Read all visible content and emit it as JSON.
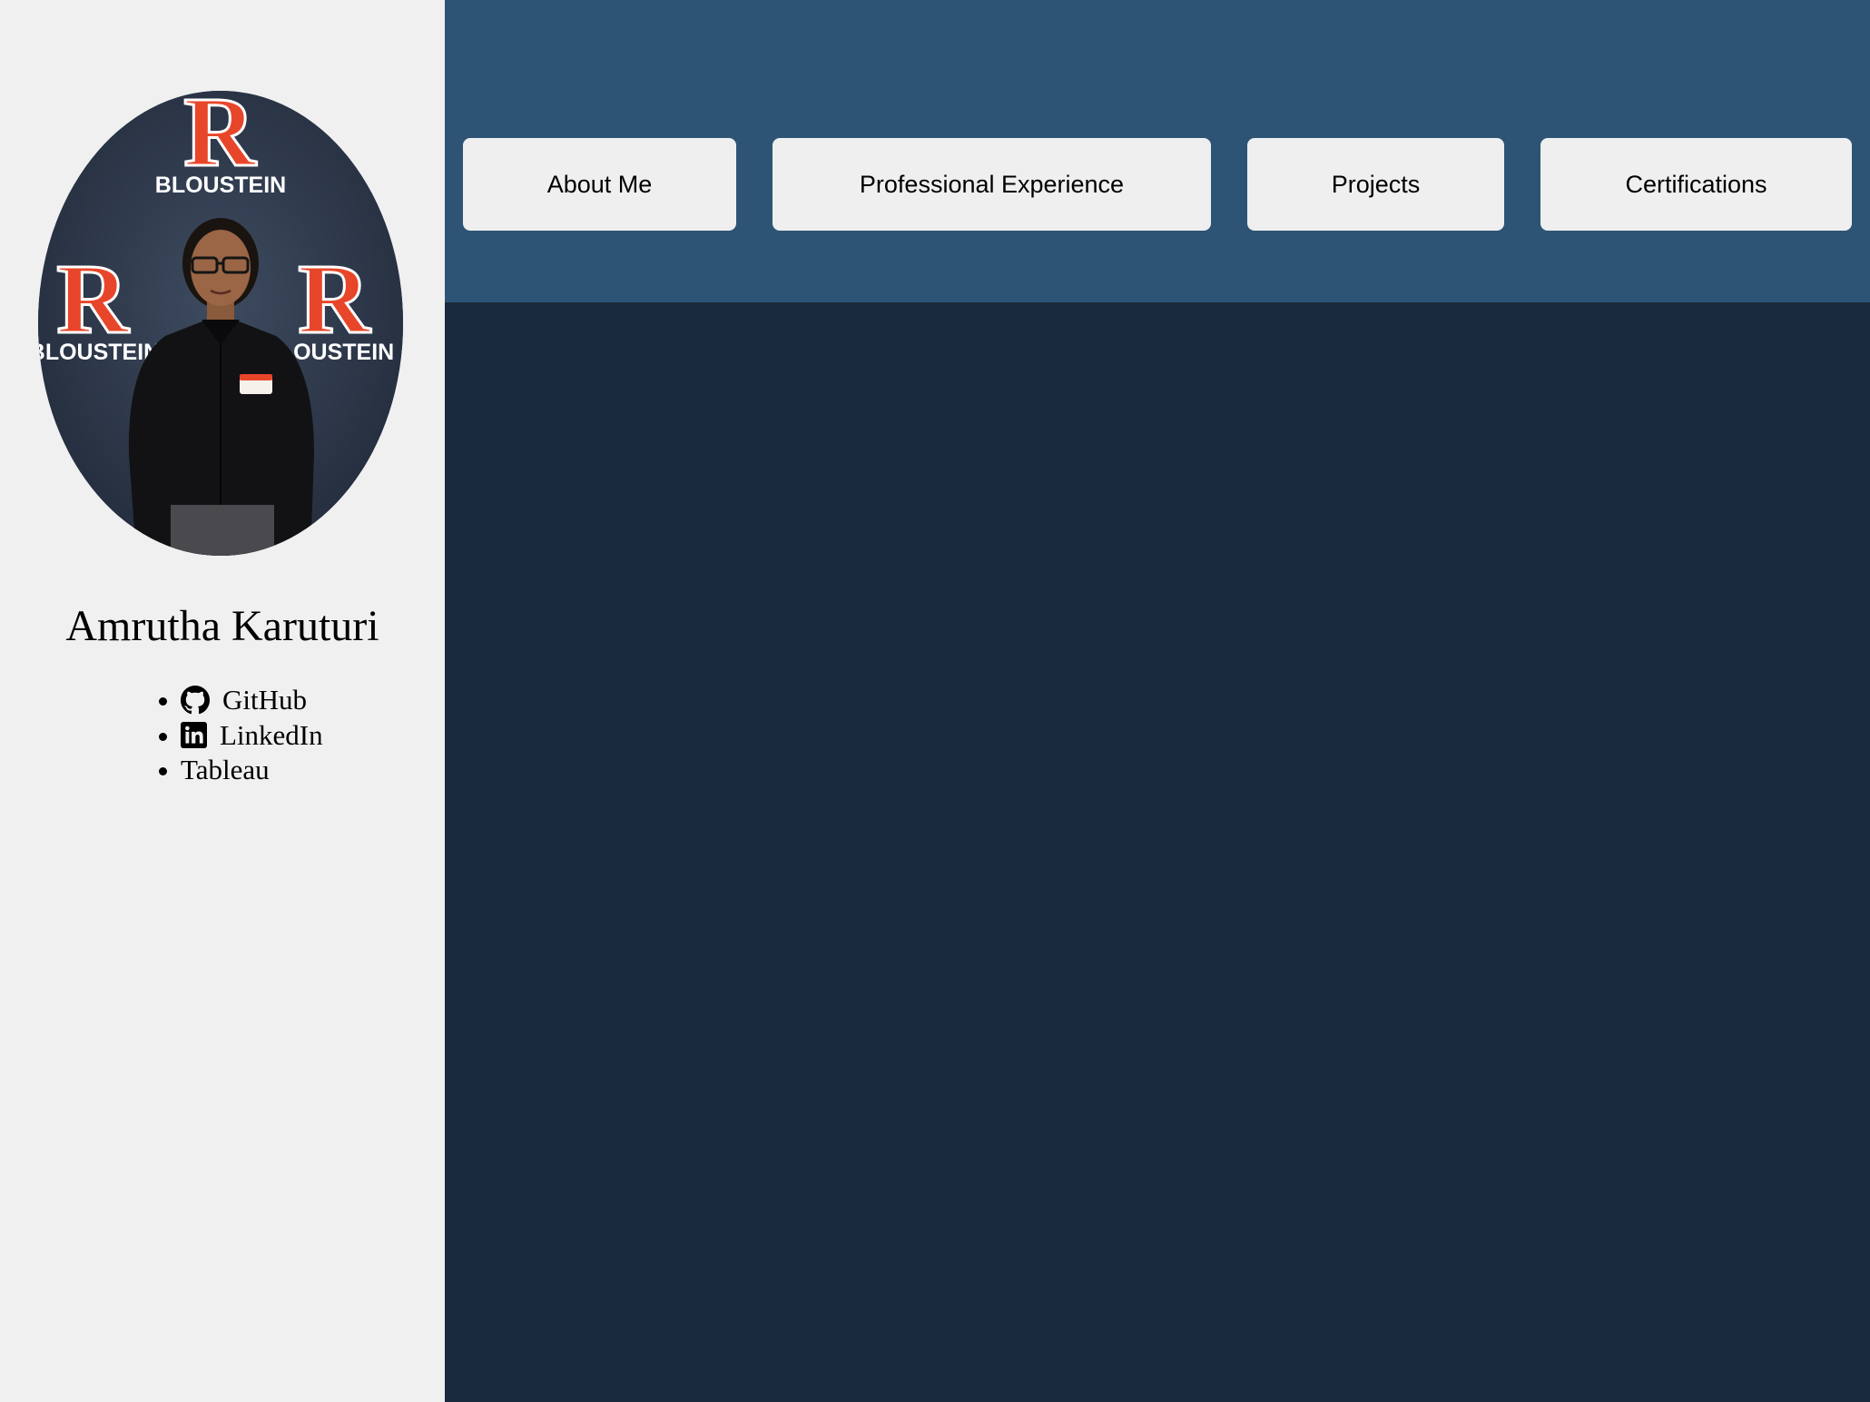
{
  "profile": {
    "name": "Amrutha Karuturi",
    "backdrop_text": "BLOUSTEIN",
    "backdrop_letter": "R"
  },
  "links": [
    {
      "label": "GitHub",
      "icon": "github-icon"
    },
    {
      "label": "LinkedIn",
      "icon": "linkedin-icon"
    },
    {
      "label": "Tableau",
      "icon": ""
    }
  ],
  "nav": {
    "about_label": "About Me",
    "experience_label": "Professional Experience",
    "projects_label": "Projects",
    "certifications_label": "Certifications"
  },
  "colors": {
    "sidebar_bg": "#f0f0f0",
    "header_bg": "#2e5475",
    "content_bg": "#182a3b",
    "button_bg": "#efefef",
    "brand_red": "#e8462a"
  }
}
